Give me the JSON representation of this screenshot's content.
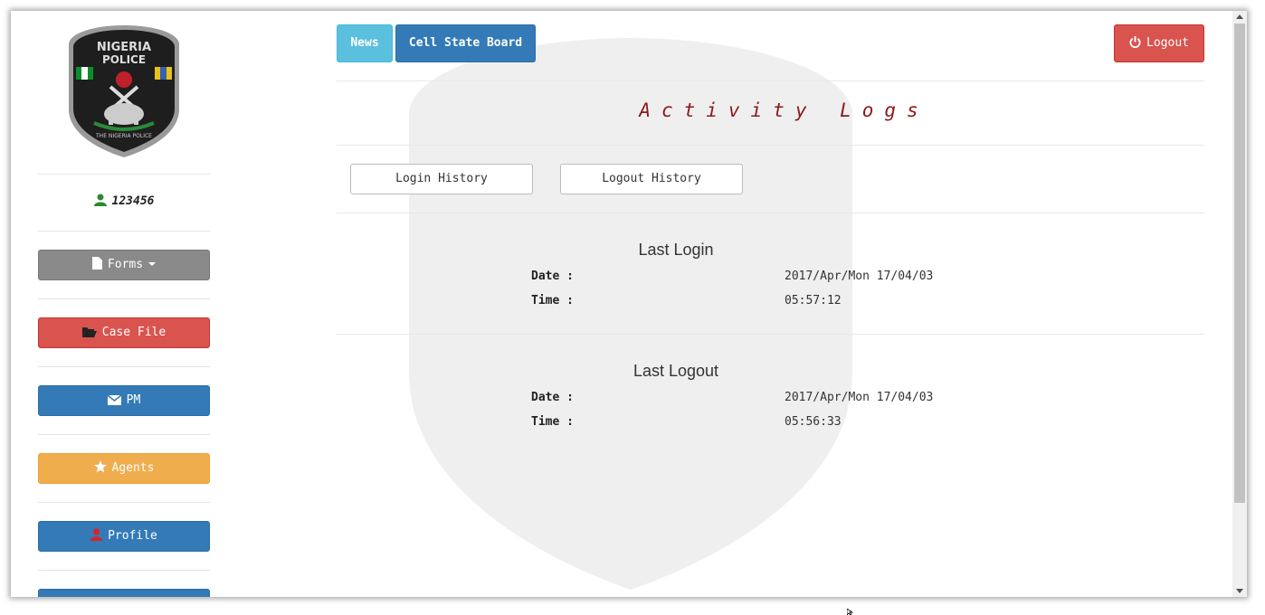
{
  "brand": {
    "logo_text_top": "NIGERIA",
    "logo_text_mid": "POLICE",
    "logo_text_bottom": "THE NIGERIA POLICE"
  },
  "user": {
    "id": "123456"
  },
  "sidebar": {
    "items": [
      {
        "label": "Forms",
        "icon": "file-icon",
        "color": "#8a8a8a"
      },
      {
        "label": "Case File",
        "icon": "folder-open-icon",
        "color": "#d9534f"
      },
      {
        "label": "PM",
        "icon": "envelope-icon",
        "color": "#337ab7"
      },
      {
        "label": "Agents",
        "icon": "star-icon",
        "color": "#f0ad4e"
      },
      {
        "label": "Profile",
        "icon": "user-icon",
        "color": "#337ab7"
      }
    ]
  },
  "topnav": {
    "news_label": "News",
    "cell_state_board_label": "Cell State Board",
    "logout_label": "Logout"
  },
  "page": {
    "title": "Activity Logs",
    "login_history_label": "Login History",
    "logout_history_label": "Logout History"
  },
  "last_login": {
    "heading": "Last Login",
    "date_label": "Date :",
    "date_value": "2017/Apr/Mon 17/04/03",
    "time_label": "Time :",
    "time_value": "05:57:12"
  },
  "last_logout": {
    "heading": "Last Logout",
    "date_label": "Date :",
    "date_value": "2017/Apr/Mon 17/04/03",
    "time_label": "Time :",
    "time_value": "05:56:33"
  }
}
